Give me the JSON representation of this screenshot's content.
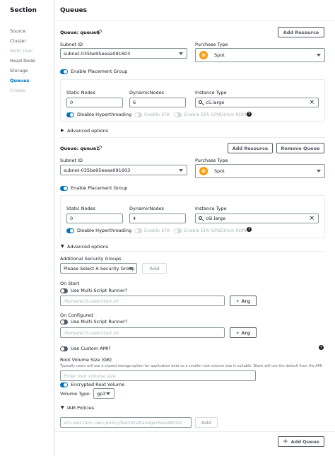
{
  "sidebar": {
    "title": "Section",
    "items": [
      {
        "label": "Source",
        "state": "normal"
      },
      {
        "label": "Cluster",
        "state": "normal"
      },
      {
        "label": "Multi User",
        "state": "disabled"
      },
      {
        "label": "Head Node",
        "state": "normal"
      },
      {
        "label": "Storage",
        "state": "normal"
      },
      {
        "label": "Queues",
        "state": "active"
      },
      {
        "label": "Create",
        "state": "disabled"
      }
    ]
  },
  "main": {
    "title": "Queues",
    "queues": [
      {
        "title": "Queue: queue0",
        "subnet_label": "Subnet ID",
        "subnet_value": "subnet-035be95eeaa091603",
        "purchase_label": "Purchase Type",
        "purchase_value": "Spot",
        "placement_label": "Enable Placement Group",
        "static_label": "Static Nodes",
        "static_value": "0",
        "dynamic_label": "DynamicNodes",
        "dynamic_value": "6",
        "instance_label": "Instance Type",
        "instance_value": "c5.large",
        "hyperthreading_label": "Disable Hyperthreading",
        "efa_label": "Enable EFA",
        "efa_rdma_label": "Enable EFA GPUDirect RDMA",
        "advanced_label": "Advanced options"
      },
      {
        "title": "Queue: queue1",
        "subnet_label": "Subnet ID",
        "subnet_value": "subnet-035be95eeaa091603",
        "purchase_label": "Purchase Type",
        "purchase_value": "Spot",
        "placement_label": "Enable Placement Group",
        "static_label": "Static Nodes",
        "static_value": "0",
        "dynamic_label": "DynamicNodes",
        "dynamic_value": "4",
        "instance_label": "Instance Type",
        "instance_value": "c6i.large",
        "hyperthreading_label": "Disable Hyperthreading",
        "efa_label": "Enable EFA",
        "efa_rdma_label": "Enable EFA GPUDirect RDMA",
        "advanced_label": "Advanced options"
      }
    ],
    "add_resource_label": "Add Resource",
    "remove_queue_label": "Remove Queue",
    "advanced": {
      "security_groups_label": "Additional Security Groups",
      "security_groups_placeholder": "Please Select A Security Group",
      "add_label": "Add",
      "on_start_label": "On Start",
      "multi_script_label": "Use Multi-Script Runner?",
      "on_start_placeholder": "/home/ec2-user/start.sh",
      "add_arg_label": "+ Arg",
      "on_configured_label": "On Configured",
      "on_configured_placeholder": "/home/ec2-user/start.sh",
      "custom_ami_label": "Use Custom AMI?",
      "root_volume_label": "Root Volume Size (GB)",
      "root_volume_help": "Typically users will use a shared storage option for application data so a smaller root volume size is suitable. Blank will use the default from the AMI.",
      "root_volume_placeholder": "Enter root volume size",
      "encrypted_label": "Encrypted Root Volume",
      "volume_type_label": "Volume Type:",
      "volume_type_value": "gp3",
      "iam_label": "IAM Policies",
      "iam_placeholder": "arn:aws:iam::aws:policy/SecretsManagerReadWrite",
      "iam_add_label": "Add"
    },
    "add_queue_label": "Add Queue",
    "help_glyph": "?"
  }
}
